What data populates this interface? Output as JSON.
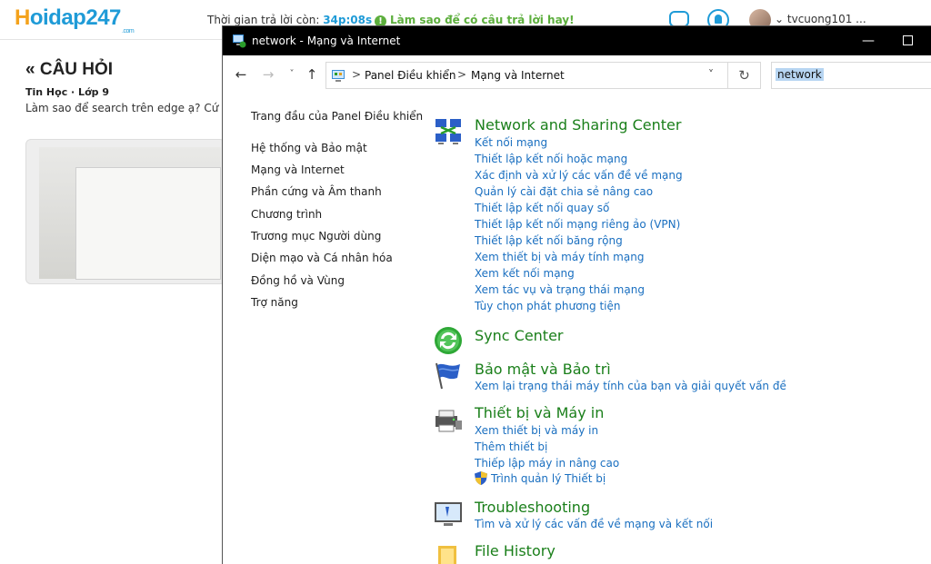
{
  "site": {
    "logo_h": "H",
    "logo_rest": "oidap247",
    "logo_sub": ".com",
    "timer_label": "Thời gian trả lời còn: ",
    "timer_value": "34p:08s",
    "hint_icon": "!",
    "hint_text": "Làm sao để có câu trả lời hay!",
    "username": "tvcuong101 ...",
    "page_title": "« CÂU HỎI",
    "subject": "Tin Học · Lớp 9",
    "question": "Làm sao để search trên edge ạ? Cứ bị lỗ"
  },
  "window": {
    "title": "network - Mạng và Internet",
    "minimize": "—",
    "nav": {
      "back": "←",
      "forward": "→",
      "recent": "˅",
      "up": "↑",
      "refresh": "↻"
    },
    "address": {
      "sep": ">",
      "crumb1": "Panel Điều khiển",
      "crumb2": "Mạng và Internet",
      "dropdown": "˅"
    },
    "search_value": "network"
  },
  "leftnav": [
    "Trang đầu của Panel Điều khiển",
    "Hệ thống và Bảo mật",
    "Mạng và Internet",
    "Phần cứng và Âm thanh",
    "Chương trình",
    "Trương mục Người dùng",
    "Diện mạo và Cá nhân hóa",
    "Đồng hồ và Vùng",
    "Trợ năng"
  ],
  "categories": {
    "network_sharing": {
      "title": "Network and Sharing Center",
      "links": [
        "Kết nối mạng",
        "Thiết lập kết nối hoặc mạng",
        "Xác định và xử lý các vấn đề về mạng",
        "Quản lý cài đặt chia sẻ nâng cao",
        "Thiết lập kết nối quay số",
        "Thiết lập kết nối mạng riêng ảo (VPN)",
        "Thiết lập kết nối băng rộng",
        "Xem thiết bị và máy tính mạng",
        "Xem kết nối mạng",
        "Xem tác vụ và trạng thái mạng",
        "Tùy chọn phát phương tiện"
      ]
    },
    "sync": {
      "title": "Sync Center"
    },
    "security": {
      "title": "Bảo mật và Bảo trì",
      "links": [
        "Xem lại trạng thái máy tính của bạn và giải quyết vấn đề"
      ]
    },
    "devices": {
      "title": "Thiết bị và Máy in",
      "links": [
        "Xem thiết bị và máy in",
        "Thêm thiết bị",
        "Thiếp lập máy in nâng cao",
        "Trình quản lý Thiết bị"
      ]
    },
    "troubleshooting": {
      "title": "Troubleshooting",
      "links": [
        "Tìm và xử lý các vấn đề về mạng và kết nối"
      ]
    },
    "file_history": {
      "title": "File History"
    }
  }
}
